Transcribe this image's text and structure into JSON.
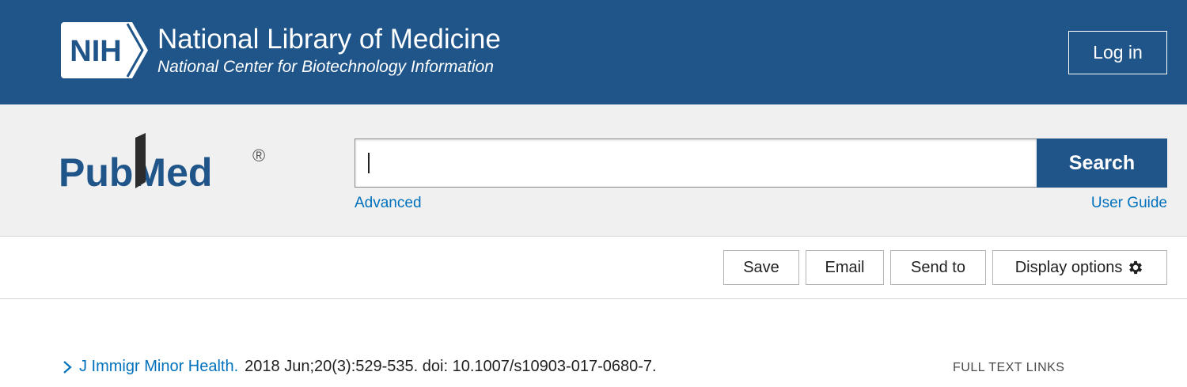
{
  "header": {
    "logo_text": "NIH",
    "title": "National Library of Medicine",
    "subtitle": "National Center for Biotechnology Information",
    "login_label": "Log in"
  },
  "search": {
    "logo_text": "PubMed",
    "logo_mark": "®",
    "query": "",
    "button_label": "Search",
    "advanced_label": "Advanced",
    "user_guide_label": "User Guide"
  },
  "toolbar": {
    "save_label": "Save",
    "email_label": "Email",
    "send_to_label": "Send to",
    "display_options_label": "Display options",
    "display_options_icon": "gear-icon"
  },
  "citation": {
    "expand_icon": "chevron-right-icon",
    "journal": "J Immigr Minor Health.",
    "details": "2018 Jun;20(3):529-535. doi: 10.1007/s10903-017-0680-7."
  },
  "full_text": {
    "label": "FULL TEXT LINKS"
  },
  "colors": {
    "header_bg": "#20558a",
    "search_band_bg": "#f0f0f0",
    "link": "#0071bc",
    "search_button": "#20558a"
  }
}
